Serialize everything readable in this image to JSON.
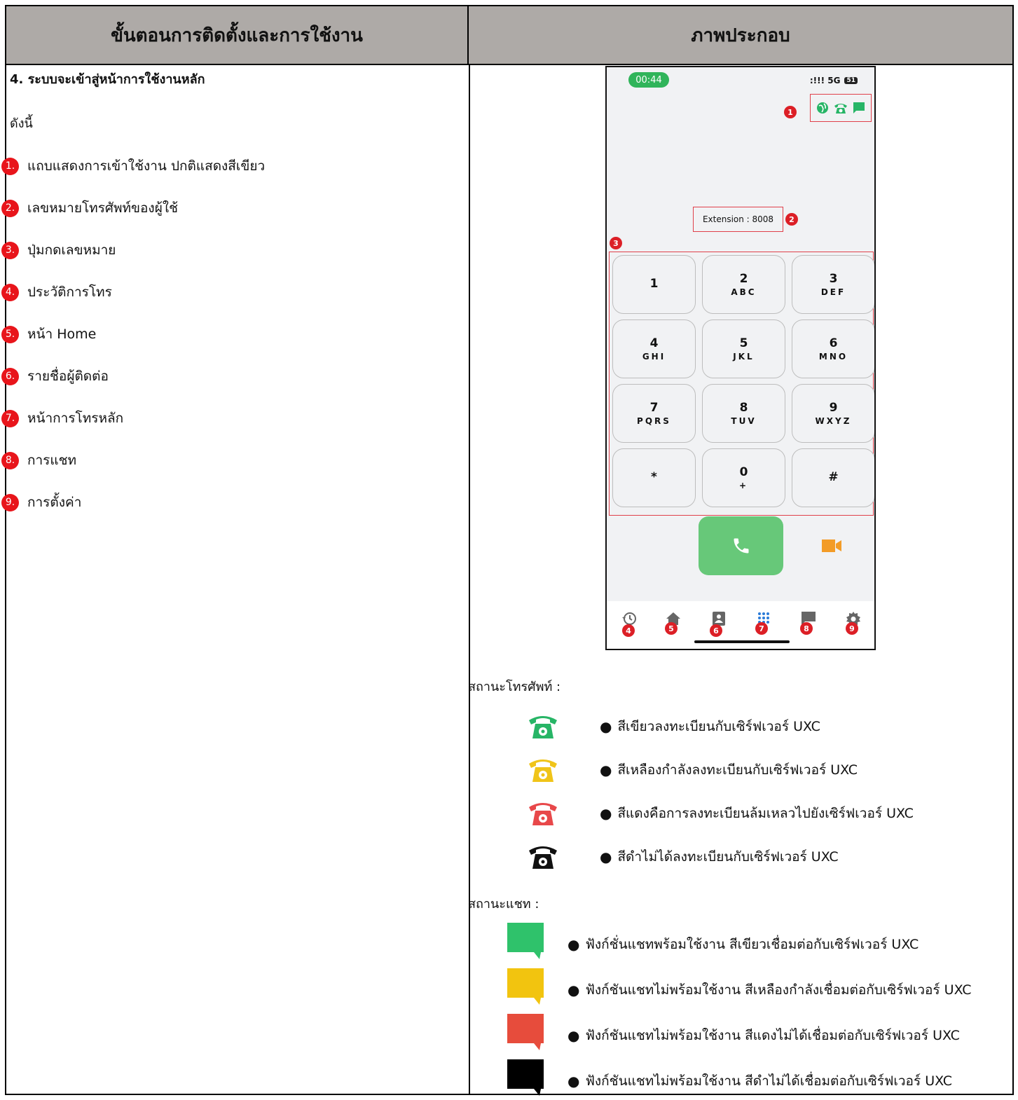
{
  "header": {
    "left": "ขั้นตอนการติดตั้งและการใช้งาน",
    "right": "ภาพประกอบ"
  },
  "step": {
    "title": "4. ระบบจะเข้าสู่หน้าการใช้งานหลัก",
    "intro": "ดังนี้"
  },
  "legend": [
    {
      "num": "1.",
      "label": "แถบแสดงการเข้าใช้งาน ปกติแสดงสีเขียว"
    },
    {
      "num": "2.",
      "label": "เลขหมายโทรศัพท์ของผู้ใช้"
    },
    {
      "num": "3.",
      "label": "ปุ่มกดเลขหมาย"
    },
    {
      "num": "4.",
      "label": "ประวัติการโทร"
    },
    {
      "num": "5.",
      "label": "หน้า Home"
    },
    {
      "num": "6.",
      "label": "รายชื่อผู้ติดต่อ"
    },
    {
      "num": "7.",
      "label": "หน้าการโทรหลัก"
    },
    {
      "num": "8.",
      "label": "การแชท"
    },
    {
      "num": "9.",
      "label": "การตั้งค่า"
    }
  ],
  "phone": {
    "time": "00:44",
    "network": ":!!! 5G",
    "battery": "51",
    "extension": "Extension : 8008",
    "keys": [
      {
        "n": "1",
        "l": ""
      },
      {
        "n": "2",
        "l": "ABC"
      },
      {
        "n": "3",
        "l": "DEF"
      },
      {
        "n": "4",
        "l": "GHI"
      },
      {
        "n": "5",
        "l": "JKL"
      },
      {
        "n": "6",
        "l": "MNO"
      },
      {
        "n": "7",
        "l": "PQRS"
      },
      {
        "n": "8",
        "l": "TUV"
      },
      {
        "n": "9",
        "l": "WXYZ"
      },
      {
        "n": "*",
        "l": ""
      },
      {
        "n": "0",
        "l": "+"
      },
      {
        "n": "#",
        "l": ""
      }
    ],
    "badges": [
      "1",
      "2",
      "3",
      "4",
      "5",
      "6",
      "7",
      "8",
      "9"
    ],
    "tabs": [
      "history-icon",
      "home-icon",
      "contacts-icon",
      "dialpad-icon",
      "chat-icon",
      "settings-icon"
    ]
  },
  "phone_status": {
    "label": "สถานะโทรศัพท์ :",
    "items": [
      {
        "color": "#27b566",
        "text": "สีเขียวลงทะเบียนกับเซิร์ฟเวอร์ UXC"
      },
      {
        "color": "#f0c419",
        "text": "สีเหลืองกำลังลงทะเบียนกับเซิร์ฟเวอร์ UXC"
      },
      {
        "color": "#e8484a",
        "text": "สีแดงคือการลงทะเบียนล้มเหลวไปยังเซิร์ฟเวอร์ UXC"
      },
      {
        "color": "#111111",
        "text": "สีดำไม่ได้ลงทะเบียนกับเซิร์ฟเวอร์ UXC"
      }
    ]
  },
  "chat_status": {
    "label": "สถานะแชท :",
    "items": [
      {
        "color": "#2fc26b",
        "text": "ฟังก์ชั่นแชทพร้อมใช้งาน สีเขียวเชื่อมต่อกับเซิร์ฟเวอร์ UXC"
      },
      {
        "color": "#f2c40f",
        "text": "ฟังก์ชันแชทไม่พร้อมใช้งาน สีเหลืองกำลังเชื่อมต่อกับเซิร์ฟเวอร์ UXC"
      },
      {
        "color": "#e74c3c",
        "text": "ฟังก์ชันแชทไม่พร้อมใช้งาน สีแดงไม่ได้เชื่อมต่อกับเซิร์ฟเวอร์ UXC"
      },
      {
        "color": "#000000",
        "text": "ฟังก์ชันแชทไม่พร้อมใช้งาน สีดำไม่ได้เชื่อมต่อกับเซิร์ฟเวอร์ UXC"
      }
    ]
  }
}
